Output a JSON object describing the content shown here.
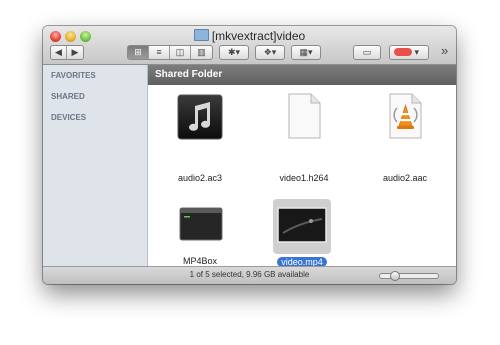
{
  "window": {
    "title": "[mkvextract]video",
    "path_bar": "Shared Folder",
    "status_text": "1 of 5 selected, 9.96 GB available"
  },
  "toolbar": {
    "back": "◀",
    "forward": "▶",
    "view_icon": "⊞",
    "view_list": "≡",
    "view_columns": "◫",
    "view_coverflow": "▥",
    "action": "✱▾",
    "dropbox": "❖▾",
    "arrange": "▦▾",
    "new_folder": "▭",
    "label": "▾",
    "overflow": "»"
  },
  "sidebar": {
    "sections": [
      "FAVORITES",
      "SHARED",
      "DEVICES"
    ]
  },
  "files": [
    {
      "name": "audio2.ac3",
      "icon": "music-file-icon",
      "selected": false
    },
    {
      "name": "video1.h264",
      "icon": "blank-document-icon",
      "selected": false
    },
    {
      "name": "audio2.aac",
      "icon": "vlc-audio-icon",
      "selected": false
    },
    {
      "name": "MP4Box",
      "icon": "terminal-executable-icon",
      "selected": false
    },
    {
      "name": "video.mp4",
      "icon": "video-thumbnail-icon",
      "selected": true
    }
  ],
  "colors": {
    "selection": "#3a74d2",
    "sidebar": "#dfe4eb",
    "path_bar": "#6b6b6b"
  }
}
